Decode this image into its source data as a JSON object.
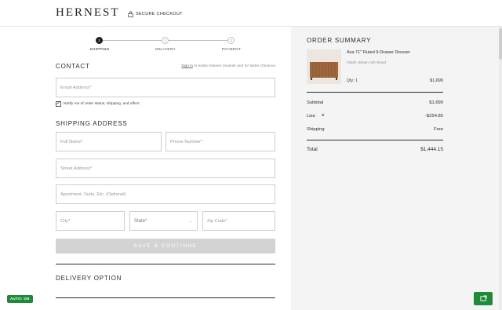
{
  "header": {
    "logo": "HERNEST",
    "secure_label": "SECURE CHECKOUT"
  },
  "progress": {
    "steps": [
      {
        "number": "1",
        "label": "SHIPPING",
        "active": true
      },
      {
        "number": "2",
        "label": "DELIVERY",
        "active": false
      },
      {
        "number": "3",
        "label": "PAYMENT",
        "active": false
      }
    ]
  },
  "contact": {
    "heading": "CONTACT",
    "signin_link": "Sign in",
    "signin_rest": "to easily redeem rewards and for faster checkout",
    "email_placeholder": "Email Address*",
    "notify_checked": true,
    "notify_label": "Notify me of order status, shipping, and offers"
  },
  "shipping": {
    "heading": "SHIPPING ADDRESS",
    "full_name_placeholder": "Full Name*",
    "phone_placeholder": "Phone Number*",
    "street_placeholder": "Street Address*",
    "apt_placeholder": "Apartment, Suite, Etc. (Optional)",
    "city_placeholder": "City*",
    "state_placeholder": "State*",
    "zip_placeholder": "Zip Code*",
    "continue_label": "SAVE & CONTINUE"
  },
  "delivery": {
    "heading": "DELIVERY OPTION"
  },
  "auto_badge": "AUTO: ON",
  "order_summary": {
    "title": "ORDER SUMMARY",
    "product": {
      "name": "Ava 71\" Fluted 9-Drawer Dresser",
      "finish": "Finish: Brown Ash Wood",
      "qty": "Qty: 1",
      "price": "$1,699"
    },
    "subtotal_label": "Subtotal",
    "subtotal_value": "$1,699",
    "discount_label": "Lisa",
    "discount_value": "-$254.85",
    "shipping_label": "Shipping",
    "shipping_value": "Free",
    "total_label": "Total",
    "total_value": "$1,444.15"
  },
  "colors": {
    "accent_green": "#1e8b3a",
    "summary_bg": "#f4f4f4",
    "button_disabled": "#d3d3d3"
  },
  "icons": {
    "secure": "lock-icon",
    "remove_discount": "close-icon",
    "state_select": "chevron-down-icon",
    "widget": "chat-widget-icon"
  }
}
